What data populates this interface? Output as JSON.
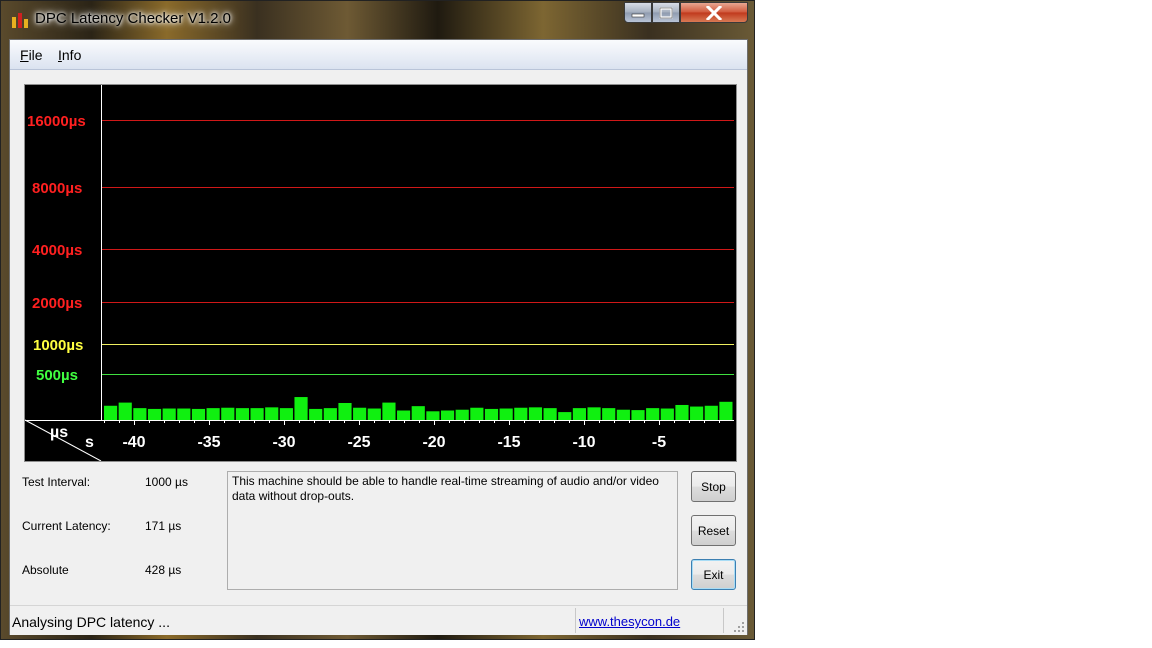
{
  "window": {
    "title": "DPC Latency Checker V1.2.0"
  },
  "menu": {
    "file": {
      "accel": "F",
      "rest": "ile"
    },
    "info": {
      "accel": "I",
      "rest": "nfo"
    }
  },
  "graph": {
    "y_lines": [
      {
        "label": "16000µs",
        "color": "#ff2020",
        "line_color": "#d01818"
      },
      {
        "label": "8000µs",
        "color": "#ff2020",
        "line_color": "#d01818"
      },
      {
        "label": "4000µs",
        "color": "#ff2020",
        "line_color": "#d01818"
      },
      {
        "label": "2000µs",
        "color": "#ff2020",
        "line_color": "#d01818"
      },
      {
        "label": "1000µs",
        "color": "#ffff40",
        "line_color": "#f0f060"
      },
      {
        "label": "500µs",
        "color": "#40ff40",
        "line_color": "#40e040"
      }
    ],
    "unit_top": "µs",
    "unit_bottom": "s",
    "x_ticks": [
      "-40",
      "-35",
      "-30",
      "-25",
      "-20",
      "-15",
      "-10",
      "-5"
    ],
    "bar_color": "#10f010",
    "latencies_us": [
      180,
      220,
      150,
      140,
      145,
      145,
      140,
      150,
      155,
      150,
      150,
      160,
      150,
      290,
      140,
      150,
      215,
      155,
      145,
      220,
      120,
      175,
      110,
      120,
      130,
      155,
      140,
      145,
      155,
      160,
      150,
      100,
      150,
      160,
      150,
      130,
      125,
      150,
      145,
      190,
      170,
      180,
      230
    ]
  },
  "info": {
    "test_interval_label": "Test Interval:",
    "test_interval_value": "1000 µs",
    "current_latency_label": "Current Latency:",
    "current_latency_value": "171 µs",
    "absolute_label": "Absolute",
    "absolute_value": "428 µs",
    "message": "This machine should be able to handle real-time streaming of audio and/or video data without drop-outs."
  },
  "buttons": {
    "stop": "Stop",
    "reset": "Reset",
    "exit": "Exit"
  },
  "status": {
    "text": "Analysing DPC latency ...",
    "link": "www.thesycon.de"
  }
}
